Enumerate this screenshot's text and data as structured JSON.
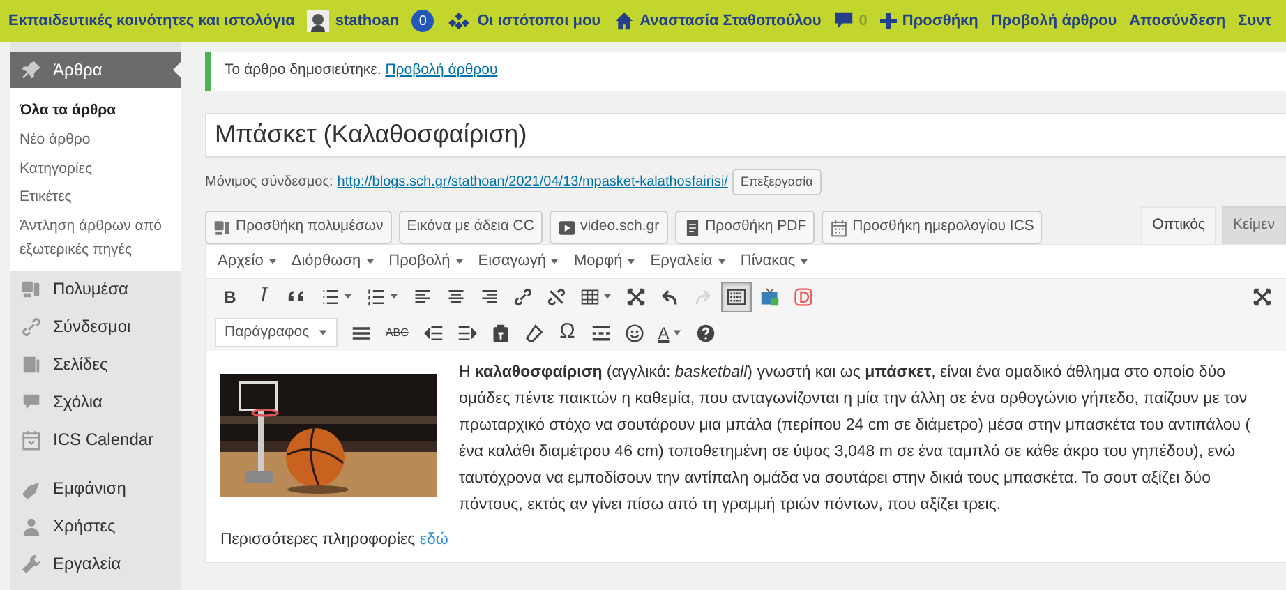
{
  "admin_bar": {
    "items": [
      {
        "kind": "network",
        "text": "Εκπαιδευτικές κοινότητες και ιστολόγια"
      },
      {
        "kind": "avatar",
        "text": "stathoan"
      },
      {
        "kind": "count",
        "text": "0"
      },
      {
        "kind": "sites",
        "text": "Οι ιστότοποι μου"
      },
      {
        "kind": "home",
        "text": "Αναστασία Σταθοπούλου"
      },
      {
        "kind": "comments",
        "text": "0"
      },
      {
        "kind": "add",
        "text": "Προσθήκη"
      },
      {
        "kind": "plain",
        "text": "Προβολή άρθρου"
      },
      {
        "kind": "plain",
        "text": "Αποσύνδεση"
      },
      {
        "kind": "plain",
        "text": "Συντ"
      }
    ]
  },
  "sidebar": {
    "items": [
      {
        "label": "Άρθρα",
        "kind": "pin",
        "selected": true,
        "children": [
          {
            "label": "Όλα τα άρθρα",
            "selected": true
          },
          {
            "label": "Νέο άρθρο",
            "selected": false
          },
          {
            "label": "Κατηγορίες",
            "selected": false
          },
          {
            "label": "Ετικέτες",
            "selected": false
          },
          {
            "label": "Άντληση άρθρων από εξωτερικές πηγές",
            "selected": false
          }
        ]
      },
      {
        "label": "Πολυμέσα",
        "kind": "media",
        "selected": false
      },
      {
        "label": "Σύνδεσμοι",
        "kind": "link",
        "selected": false
      },
      {
        "label": "Σελίδες",
        "kind": "pages",
        "selected": false
      },
      {
        "label": "Σχόλια",
        "kind": "comment",
        "selected": false
      },
      {
        "label": "ICS Calendar",
        "kind": "calendar",
        "selected": false
      },
      {
        "label": "Εμφάνιση",
        "kind": "brush",
        "selected": false
      },
      {
        "label": "Χρήστες",
        "kind": "user",
        "selected": false
      },
      {
        "label": "Εργαλεία",
        "kind": "wrench",
        "selected": false
      }
    ]
  },
  "notice": {
    "text": "Το άρθρο δημοσιεύτηκε.",
    "link": "Προβολή άρθρου"
  },
  "post_title": "Μπάσκετ (Καλαθοσφαίριση)",
  "permalink": {
    "label": "Μόνιμος σύνδεσμος:",
    "url": "http://blogs.sch.gr/stathoan/2021/04/13/mpasket-kalathosfairisi/",
    "button": "Επεξεργασία"
  },
  "media_buttons": [
    {
      "kind": "media",
      "text": "Προσθήκη πολυμέσων"
    },
    {
      "kind": "plain",
      "text": "Εικόνα με άδεια CC"
    },
    {
      "kind": "video",
      "text": "video.sch.gr"
    },
    {
      "kind": "pdf",
      "text": "Προσθήκη PDF"
    },
    {
      "kind": "calendar",
      "text": "Προσθήκη ημερολογίου ICS"
    }
  ],
  "editor_tabs": [
    {
      "label": "Οπτικός",
      "selected": true
    },
    {
      "label": "Κείμεν",
      "selected": false
    }
  ],
  "menubar": [
    "Αρχείο",
    "Διόρθωση",
    "Προβολή",
    "Εισαγωγή",
    "Μορφή",
    "Εργαλεία",
    "Πίνακας"
  ],
  "toolbar_1": [
    {
      "kind": "bold",
      "text": "B",
      "pressed": false,
      "disabled": false
    },
    {
      "kind": "italic",
      "text": "I",
      "pressed": false,
      "disabled": false
    },
    {
      "kind": "quote",
      "pressed": false,
      "disabled": false
    },
    {
      "kind": "bullets",
      "pressed": false,
      "disabled": false
    },
    {
      "kind": "numbers",
      "pressed": false,
      "disabled": false
    },
    {
      "kind": "alignleft",
      "pressed": false,
      "disabled": false
    },
    {
      "kind": "aligncenter",
      "pressed": false,
      "disabled": false
    },
    {
      "kind": "alignright",
      "pressed": false,
      "disabled": false
    },
    {
      "kind": "link",
      "pressed": false,
      "disabled": false
    },
    {
      "kind": "unlink",
      "pressed": false,
      "disabled": false
    },
    {
      "kind": "table",
      "pressed": false,
      "disabled": false
    },
    {
      "kind": "fullscreen",
      "pressed": false,
      "disabled": false
    },
    {
      "kind": "undo",
      "pressed": false,
      "disabled": false
    },
    {
      "kind": "redo",
      "pressed": false,
      "disabled": true
    },
    {
      "kind": "keyboard",
      "pressed": true,
      "disabled": false
    },
    {
      "kind": "tv",
      "pressed": false,
      "disabled": false
    },
    {
      "kind": "dlogo",
      "pressed": false,
      "disabled": false
    }
  ],
  "format_select": "Παράγραφος",
  "toolbar_2": [
    {
      "kind": "hr"
    },
    {
      "kind": "strike",
      "text": "ABC"
    },
    {
      "kind": "outdent"
    },
    {
      "kind": "indent"
    },
    {
      "kind": "paste"
    },
    {
      "kind": "eraser"
    },
    {
      "kind": "char",
      "text": "Ω"
    },
    {
      "kind": "more"
    },
    {
      "kind": "smiley"
    },
    {
      "kind": "color",
      "text": "A"
    },
    {
      "kind": "help"
    }
  ],
  "content": {
    "paragraph": "Η **καλαθοσφαίριση** (αγγλικά: *basketball*) γνωστή και ως **μπάσκετ**, είναι ένα ομαδικό άθλημα στο οποίο δύο ομάδες πέντε παικτών η καθεμία, που ανταγωνίζονται η μία την άλλη σε ένα ορθογώνιο γήπεδο, παίζουν με τον πρωταρχικό στόχο να σουτάρουν μια μπάλα (περίπου 24 cm σε διάμετρο) μέσα στην μπασκέτα του αντιπάλου ( ένα καλάθι διαμέτρου 46 cm) τοποθετημένη σε ύψος 3,048 m σε ένα ταμπλό σε κάθε άκρο του γηπέδου), ενώ ταυτόχρονα να εμποδίσουν την αντίπαλη ομάδα να σουτάρει στην δικιά τους μπασκέτα. Το σουτ αξίζει δύο πόντους, εκτός αν γίνει πίσω από τη γραμμή τριών πόντων, που αξίζει τρεις.",
    "more_text": "Περισσότερες πληροφορίες",
    "more_link": "εδώ"
  }
}
